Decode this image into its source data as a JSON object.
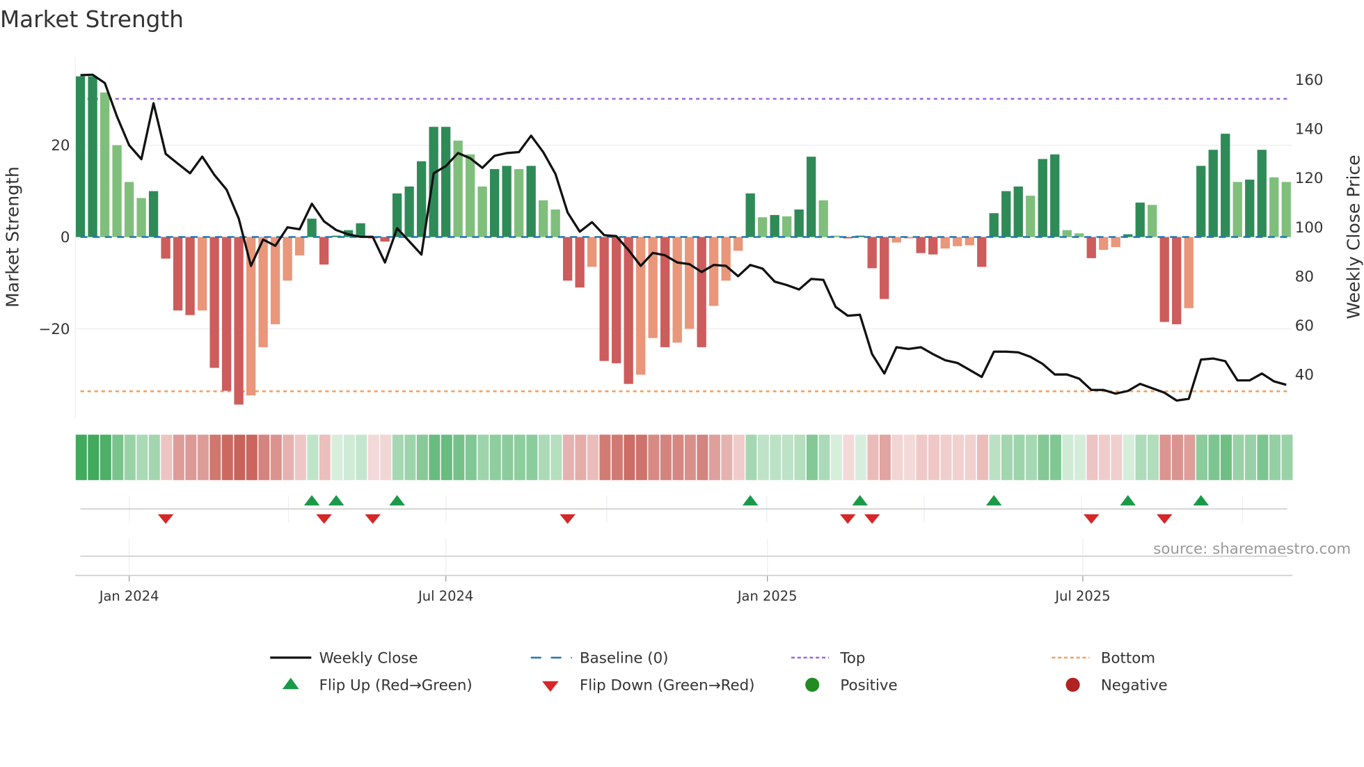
{
  "title": "Market Strength",
  "source": "source: sharemaestro.com",
  "colors": {
    "strong_pos": "#2e8b57",
    "weak_pos": "#7fbf7b",
    "strong_neg": "#cd5c5c",
    "weak_neg": "#e9967a",
    "price": "#111111",
    "baseline": "#1f77b4",
    "top": "#9966dd",
    "bottom": "#f0a060",
    "flip_up": "#1a9a48",
    "flip_down": "#d62728",
    "positive": "#228b22",
    "negative": "#b22222"
  },
  "chart_data": {
    "type": "bar",
    "title": "Market Strength",
    "ylabel": "Market Strength",
    "y2label": "Weekly Close Price",
    "x_unit": "week index",
    "ylim": [
      -39.4,
      39.2
    ],
    "y2lim": [
      22.3,
      169.3
    ],
    "yticks": [
      {
        "v": 20,
        "label": "20"
      },
      {
        "v": 0,
        "label": "0"
      },
      {
        "v": -20,
        "label": "−20"
      }
    ],
    "y2ticks": [
      {
        "v": 160,
        "label": "160"
      },
      {
        "v": 140,
        "label": "140"
      },
      {
        "v": 120,
        "label": "120"
      },
      {
        "v": 100,
        "label": "100"
      },
      {
        "v": 80,
        "label": "80"
      },
      {
        "v": 60,
        "label": "60"
      },
      {
        "v": 40,
        "label": "40"
      }
    ],
    "xticks": [
      {
        "x": 4.0,
        "label": "Jan 2024"
      },
      {
        "x": 30.0,
        "label": "Jul 2024"
      },
      {
        "x": 56.4,
        "label": "Jan 2025"
      },
      {
        "x": 82.3,
        "label": "Jul 2025"
      }
    ],
    "top_level": 30.1,
    "bottom_level": -33.6,
    "baseline": 0,
    "strength": [
      35,
      35,
      31.5,
      20,
      12,
      8.5,
      10,
      -4.7,
      -16,
      -17,
      -16,
      -28.5,
      -33.5,
      -36.5,
      -34.5,
      -24,
      -19,
      -9.5,
      -4,
      4,
      -6,
      0.3,
      1.5,
      3,
      -0.3,
      -1,
      9.5,
      11,
      16.5,
      24,
      24,
      21,
      18,
      11,
      14.8,
      15.5,
      14.8,
      15.5,
      8,
      6,
      -9.5,
      -11,
      -6.5,
      -27,
      -27.5,
      -32,
      -30,
      -22,
      -24,
      -23,
      -20,
      -24,
      -15,
      -9.5,
      -3,
      9.5,
      4.3,
      4.8,
      4.5,
      6,
      17.5,
      8,
      0.3,
      -0.3,
      0.3,
      -6.8,
      -13.5,
      -1.2,
      -0.3,
      -3.5,
      -3.8,
      -2.5,
      -2,
      -1.8,
      -6.5,
      5.2,
      10,
      11,
      9,
      17,
      18,
      1.5,
      0.8,
      -4.6,
      -2.8,
      -2.2,
      0.6,
      7.5,
      7,
      -18.5,
      -19,
      -15.5,
      15.5,
      19,
      22.5,
      12,
      12.5,
      19,
      13,
      12
    ],
    "weekly_close": [
      161.8,
      162,
      158.6,
      145,
      133.3,
      127.6,
      150.4,
      129.8,
      125.8,
      121.9,
      128.7,
      121.2,
      115.2,
      103.4,
      84.2,
      94.9,
      92.4,
      99.9,
      99.1,
      109.5,
      102.3,
      98.8,
      97,
      96,
      96,
      85.6,
      99.5,
      94.2,
      88.8,
      121.9,
      124.8,
      130.1,
      128,
      124.1,
      129,
      130.1,
      130.5,
      137.2,
      130.5,
      121.6,
      105.9,
      98.1,
      102,
      96.7,
      96.3,
      90.6,
      84.2,
      89.5,
      88.5,
      85.6,
      84.9,
      81.7,
      84.6,
      84.2,
      80,
      84.6,
      83.1,
      77.8,
      76.4,
      74.6,
      78.9,
      78.5,
      67.5,
      63.9,
      64.3,
      48.3,
      40.4,
      51.1,
      50.4,
      51.1,
      48.3,
      45.8,
      44.7,
      41.9,
      39,
      49.3,
      49.3,
      49,
      47.2,
      44.3,
      40,
      40,
      38.3,
      33.7,
      33.7,
      32.2,
      33.3,
      36.2,
      34.4,
      32.6,
      29.4,
      30.1,
      46.1,
      46.5,
      45.4,
      37.6,
      37.6,
      40.4,
      37.2,
      35.8
    ],
    "flip_up": [
      19,
      21,
      26,
      55,
      64,
      75,
      86,
      92
    ],
    "flip_down": [
      7,
      20,
      24,
      40,
      63,
      65,
      83,
      89
    ],
    "legend": {
      "placement": "bottom",
      "items": [
        {
          "label": "Weekly Close",
          "kind": "line"
        },
        {
          "label": "Baseline (0)",
          "kind": "baseline"
        },
        {
          "label": "Top",
          "kind": "top"
        },
        {
          "label": "Bottom",
          "kind": "bottom"
        },
        {
          "label": "Flip Up (Red→Green)",
          "kind": "flip_up"
        },
        {
          "label": "Flip Down (Green→Red)",
          "kind": "flip_down"
        },
        {
          "label": "Positive",
          "kind": "positive"
        },
        {
          "label": "Negative",
          "kind": "negative"
        }
      ]
    }
  }
}
